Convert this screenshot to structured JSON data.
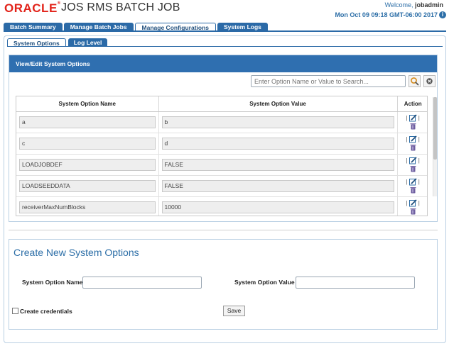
{
  "header": {
    "brand": "ORACLE",
    "title": "JOS RMS BATCH JOB",
    "welcome_prefix": "Welcome,",
    "username": "jobadmin",
    "datetime": "Mon Oct 09 09:18 GMT-06:00 2017"
  },
  "main_tabs": [
    "Batch Summary",
    "Manage Batch Jobs",
    "Manage Configurations",
    "System Logs"
  ],
  "sub_tabs": [
    "System Options",
    "Log Level"
  ],
  "view_panel": {
    "title": "View/Edit System Options",
    "search_placeholder": "Enter Option Name or Value to Search..."
  },
  "table": {
    "headers": [
      "System Option Name",
      "System Option Value",
      "Action"
    ],
    "rows": [
      {
        "name": "a",
        "value": "b"
      },
      {
        "name": "c",
        "value": "d"
      },
      {
        "name": "LOADJOBDEF",
        "value": "FALSE"
      },
      {
        "name": "LOADSEEDDATA",
        "value": "FALSE"
      },
      {
        "name": "receiverMaxNumBlocks",
        "value": "10000"
      }
    ]
  },
  "create_panel": {
    "title": "Create New System Options",
    "name_label": "System Option Name",
    "value_label": "System Option Value",
    "credentials_label": "Create credentials",
    "save_label": "Save"
  },
  "icons": {
    "edit": "edit-icon",
    "delete": "trash-icon",
    "search": "search-icon",
    "clear": "clear-icon",
    "info": "info-icon"
  },
  "colors": {
    "oracle_red": "#e2231a",
    "tab_blue": "#2b6aa7",
    "header_blue": "#2f6fb0",
    "link_blue": "#2c6ea7"
  }
}
